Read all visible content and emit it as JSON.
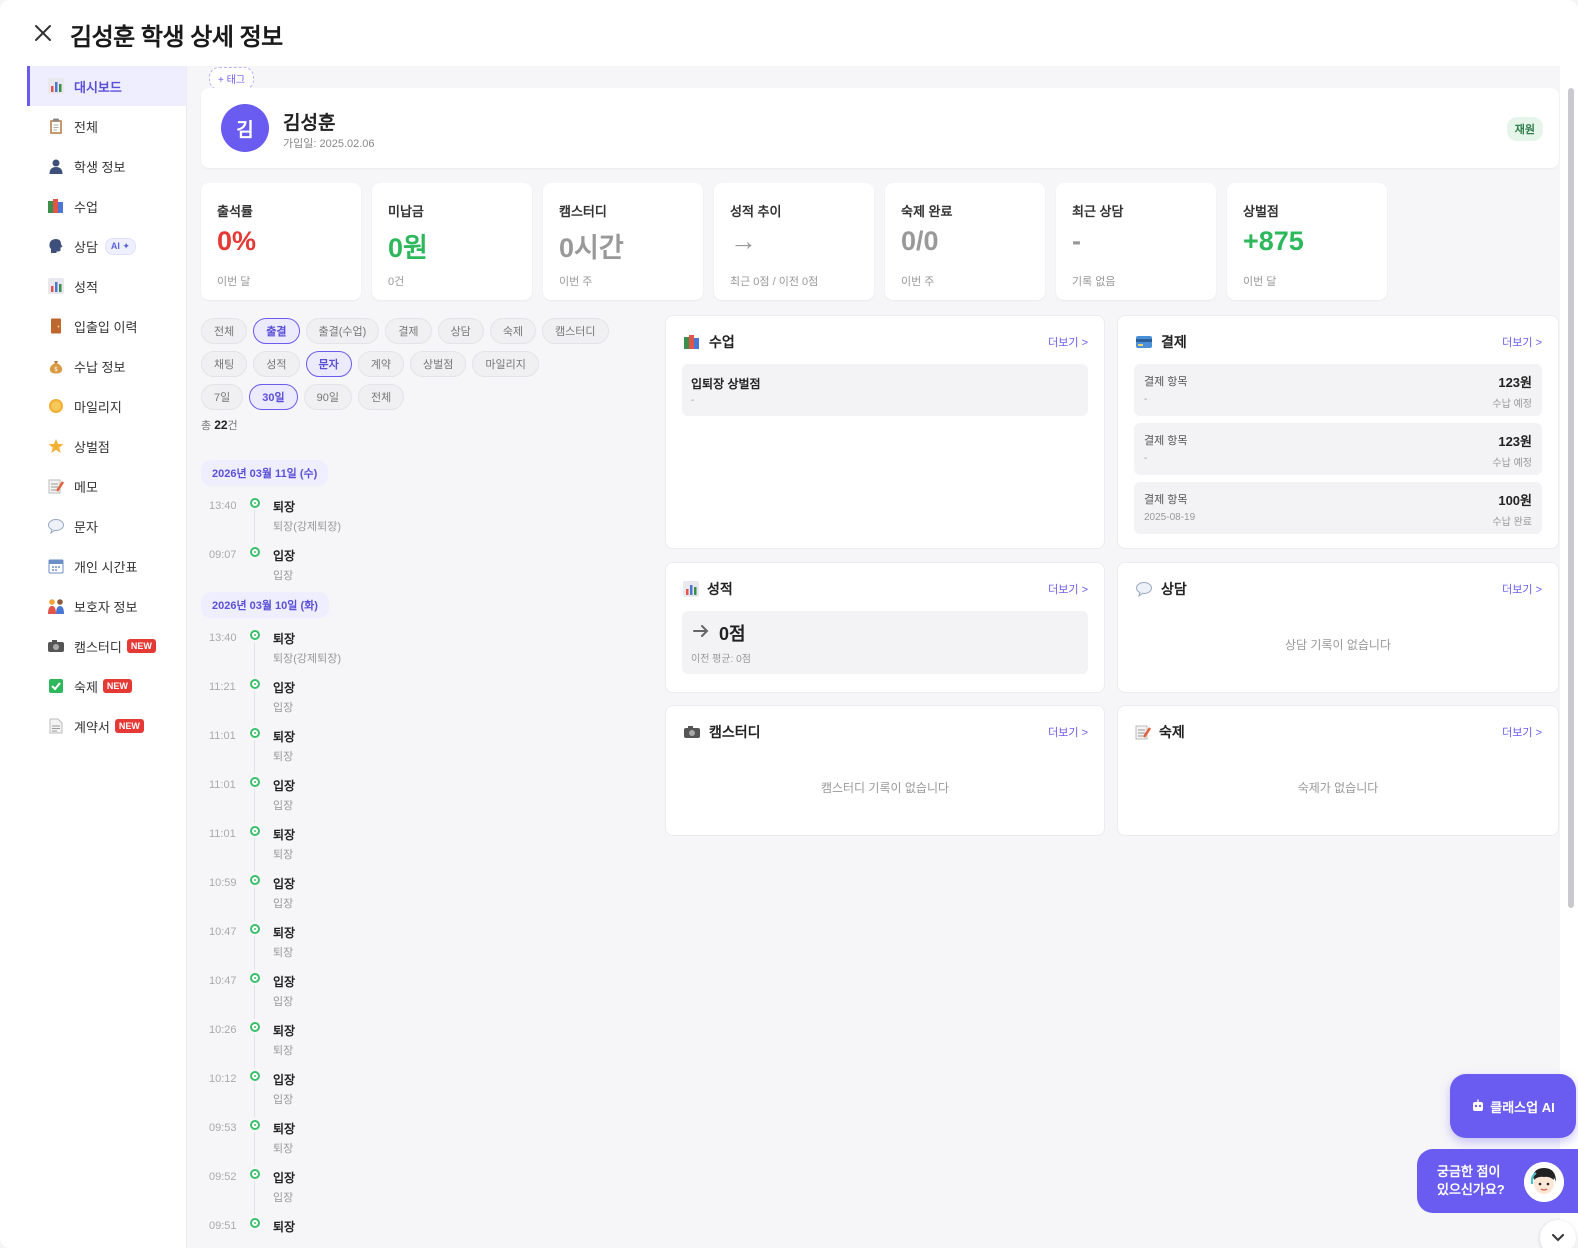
{
  "header": {
    "title": "김성훈 학생 상세 정보"
  },
  "sidebar": {
    "items": [
      {
        "label": "대시보드",
        "icon": "bar-chart-icon"
      },
      {
        "label": "전체",
        "icon": "clipboard-icon"
      },
      {
        "label": "학생 정보",
        "icon": "person-icon"
      },
      {
        "label": "수업",
        "icon": "books-icon"
      },
      {
        "label": "상담",
        "icon": "speaking-head-icon",
        "badge": "AI ✦"
      },
      {
        "label": "성적",
        "icon": "bar-chart-icon"
      },
      {
        "label": "입출입 이력",
        "icon": "door-icon"
      },
      {
        "label": "수납 정보",
        "icon": "money-bag-icon"
      },
      {
        "label": "마일리지",
        "icon": "coin-icon"
      },
      {
        "label": "상벌점",
        "icon": "star-icon"
      },
      {
        "label": "메모",
        "icon": "memo-icon"
      },
      {
        "label": "문자",
        "icon": "speech-bubble-icon"
      },
      {
        "label": "개인 시간표",
        "icon": "calendar-icon"
      },
      {
        "label": "보호자 정보",
        "icon": "family-icon"
      },
      {
        "label": "캠스터디",
        "icon": "webcam-icon",
        "badge": "NEW"
      },
      {
        "label": "숙제",
        "icon": "check-box-icon",
        "badge": "NEW"
      },
      {
        "label": "계약서",
        "icon": "document-icon",
        "badge": "NEW"
      }
    ]
  },
  "profile": {
    "tag_button": "+ 태그",
    "avatar_initial": "김",
    "name": "김성훈",
    "join_date": "가입일: 2025.02.06",
    "status": "재원"
  },
  "stats": [
    {
      "label": "출석률",
      "value": "0%",
      "sub": "이번 달",
      "color": "#e53935"
    },
    {
      "label": "미납금",
      "value": "0원",
      "sub": "0건",
      "color": "#2eb85c"
    },
    {
      "label": "캠스터디",
      "value": "0시간",
      "sub": "이번 주",
      "color": "#999999"
    },
    {
      "label": "성적 추이",
      "value": "→",
      "sub": "최근 0점 / 이전 0점",
      "color": "#999999"
    },
    {
      "label": "숙제 완료",
      "value": "0/0",
      "sub": "이번 주",
      "color": "#999999"
    },
    {
      "label": "최근 상담",
      "value": "-",
      "sub": "기록 없음",
      "color": "#999999"
    },
    {
      "label": "상벌점",
      "value": "+875",
      "sub": "이번 달",
      "color": "#2eb85c"
    }
  ],
  "filters": {
    "categories_row1": [
      "전체",
      "출결",
      "출결(수업)",
      "결제",
      "상담",
      "숙제",
      "캠스터디"
    ],
    "categories_row2": [
      "채팅",
      "성적",
      "문자",
      "계약",
      "상벌점",
      "마일리지"
    ],
    "periods": [
      "7일",
      "30일",
      "90일",
      "전체"
    ],
    "total_prefix": "총 ",
    "total_count": "22",
    "total_suffix": "건"
  },
  "timeline": {
    "groups": [
      {
        "date": "2026년 03월 11일 (수)",
        "items": [
          {
            "time": "13:40",
            "title": "퇴장",
            "sub": "퇴장(강제퇴장)"
          },
          {
            "time": "09:07",
            "title": "입장",
            "sub": "입장"
          }
        ]
      },
      {
        "date": "2026년 03월 10일 (화)",
        "items": [
          {
            "time": "13:40",
            "title": "퇴장",
            "sub": "퇴장(강제퇴장)"
          },
          {
            "time": "11:21",
            "title": "입장",
            "sub": "입장"
          },
          {
            "time": "11:01",
            "title": "퇴장",
            "sub": "퇴장"
          },
          {
            "time": "11:01",
            "title": "입장",
            "sub": "입장"
          },
          {
            "time": "11:01",
            "title": "퇴장",
            "sub": "퇴장"
          },
          {
            "time": "10:59",
            "title": "입장",
            "sub": "입장"
          },
          {
            "time": "10:47",
            "title": "퇴장",
            "sub": "퇴장"
          },
          {
            "time": "10:47",
            "title": "입장",
            "sub": "입장"
          },
          {
            "time": "10:26",
            "title": "퇴장",
            "sub": "퇴장"
          },
          {
            "time": "10:12",
            "title": "입장",
            "sub": "입장"
          },
          {
            "time": "09:53",
            "title": "퇴장",
            "sub": "퇴장"
          },
          {
            "time": "09:52",
            "title": "입장",
            "sub": "입장"
          },
          {
            "time": "09:51",
            "title": "퇴장",
            "sub": ""
          }
        ]
      }
    ]
  },
  "panels": {
    "more_label": "더보기 >",
    "class": {
      "title": "수업",
      "item_title": "입퇴장 상벌점",
      "item_sub": "-"
    },
    "payment": {
      "title": "결제",
      "items": [
        {
          "name": "결제 항목",
          "date": "-",
          "amount": "123원",
          "status": "수납 예정"
        },
        {
          "name": "결제 항목",
          "date": "-",
          "amount": "123원",
          "status": "수납 예정"
        },
        {
          "name": "결제 항목",
          "date": "2025-08-19",
          "amount": "100원",
          "status": "수납 완료"
        }
      ]
    },
    "grades": {
      "title": "성적",
      "score": "0점",
      "prev": "이전 평균: 0점"
    },
    "counsel": {
      "title": "상담",
      "empty": "상담 기록이 없습니다"
    },
    "camstudy": {
      "title": "캠스터디",
      "empty": "캠스터디 기록이 없습니다"
    },
    "homework": {
      "title": "숙제",
      "empty": "숙제가 없습니다"
    }
  },
  "floating": {
    "ai_button": "클래스업 AI",
    "help_line1": "궁금한 점이",
    "help_line2": "있으신가요?"
  },
  "colors": {
    "accent": "#6a5cf0",
    "red": "#e53935",
    "green": "#2eb85c"
  }
}
